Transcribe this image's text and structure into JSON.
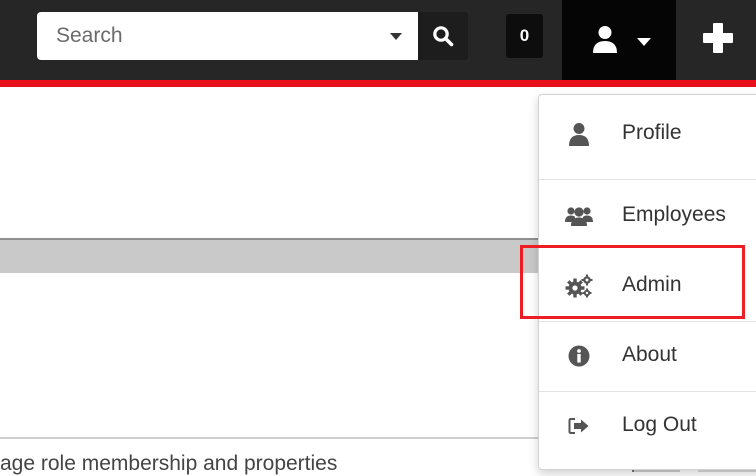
{
  "header": {
    "search": {
      "placeholder": "Search",
      "value": ""
    },
    "notification_count": "0"
  },
  "user_menu": {
    "items": [
      {
        "label": "Profile",
        "icon": "user-icon"
      },
      {
        "label": "Employees",
        "icon": "users-icon"
      },
      {
        "label": "Admin",
        "icon": "cogs-icon"
      },
      {
        "label": "About",
        "icon": "info-circle-icon"
      },
      {
        "label": "Log Out",
        "icon": "sign-out-icon"
      }
    ],
    "highlighted": "Admin"
  },
  "page": {
    "bottom_text": "age role membership and properties"
  },
  "colors": {
    "header_bg": "#262626",
    "accent_red": "#e8101a",
    "highlight": "#ee1c23"
  }
}
